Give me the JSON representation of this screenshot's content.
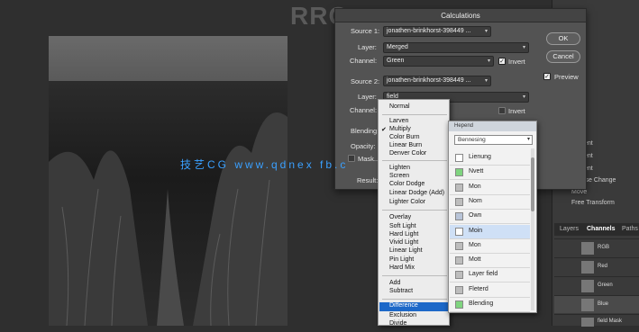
{
  "background_title": "RRG",
  "watermark": "技艺CG www.qdnex fb.c",
  "dialog": {
    "title": "Calculations",
    "source1": {
      "label": "Source 1:",
      "value": "jonathen-brinkhorst-398449 ..."
    },
    "layer1": {
      "label": "Layer:",
      "value": "Merged"
    },
    "channel1": {
      "label": "Channel:",
      "value": "Green",
      "invert_label": "Invert",
      "invert_checked": true
    },
    "source2": {
      "label": "Source 2:",
      "value": "jonathen-brinkhorst-398449 ..."
    },
    "layer2": {
      "label": "Layer:",
      "value": "field"
    },
    "channel2": {
      "label": "Channel:",
      "invert_label": "Invert",
      "invert_checked": false
    },
    "blending_label": "Blending:",
    "opacity_label": "Opacity:",
    "mask_label": "Mask...",
    "result_label": "Result:",
    "ok_label": "OK",
    "cancel_label": "Cancel",
    "preview_label": "Preview",
    "preview_checked": true
  },
  "blend_menu": {
    "items": [
      "Normal",
      "Larven",
      "Multiply",
      "Color Burn",
      "Linear Burn",
      "Denver Color",
      "Lighten",
      "Screen",
      "Color Dodge",
      "Linear Dodge (Add)",
      "Lighter Color",
      "Overlay",
      "Soft Light",
      "Hard Light",
      "Vivid Light",
      "Linear Light",
      "Pin Light",
      "Hard Mix",
      "Add",
      "Subtract",
      "Difference",
      "Exclusion",
      "Divide"
    ],
    "checked": "Multiply",
    "selected": "Difference"
  },
  "popup": {
    "header": "Hepend",
    "field": "Bennesing",
    "items": [
      {
        "label": "Lienung",
        "color": "#ffffff"
      },
      {
        "label": "Nvett",
        "color": "#7fd47f"
      },
      {
        "label": "Mon",
        "color": "#bdbdbd"
      },
      {
        "label": "Nom",
        "color": "#bdbdbd"
      },
      {
        "label": "Own",
        "color": "#b8c4d8"
      },
      {
        "label": "Moin",
        "color": "#ffffff"
      },
      {
        "label": "Mon",
        "color": "#bdbdbd"
      },
      {
        "label": "Mott",
        "color": "#bdbdbd"
      },
      {
        "label": "Layer field",
        "color": "#bdbdbd"
      },
      {
        "label": "Fleterd",
        "color": "#bdbdbd"
      },
      {
        "label": "Blending",
        "color": "#7fd47f"
      }
    ],
    "highlighted_index": 5
  },
  "history": {
    "items": [
      "Reslent",
      "Reslent",
      "Reslent",
      "Inverse Change",
      "Move",
      "Free Transform"
    ]
  },
  "panel_tabs": [
    "Layers",
    "Channels",
    "Paths"
  ],
  "channels": [
    "RGB",
    "Red",
    "Green",
    "Blue",
    "field Mask"
  ]
}
